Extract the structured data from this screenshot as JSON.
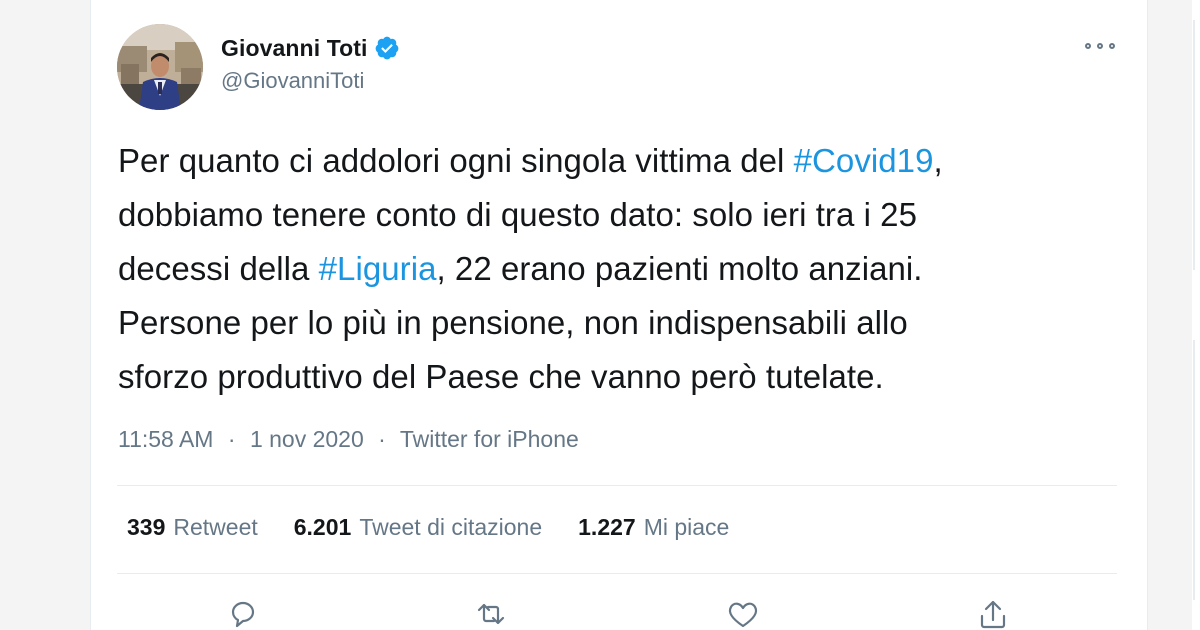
{
  "tweet": {
    "author": {
      "display_name": "Giovanni Toti",
      "handle": "@GiovanniToti",
      "verified": true,
      "verified_color": "#1da1f2"
    },
    "text_lines": [
      {
        "parts": [
          {
            "text": "Per quanto ci addolori ogni singola vittima del ",
            "hashtag": false
          },
          {
            "text": "#Covid19",
            "hashtag": true
          },
          {
            "text": ",",
            "hashtag": false
          }
        ]
      },
      {
        "parts": [
          {
            "text": "dobbiamo tenere conto di questo dato: solo ieri tra i 25",
            "hashtag": false
          }
        ]
      },
      {
        "parts": [
          {
            "text": "decessi della ",
            "hashtag": false
          },
          {
            "text": "#Liguria",
            "hashtag": true
          },
          {
            "text": ", 22 erano pazienti molto anziani.",
            "hashtag": false
          }
        ]
      },
      {
        "parts": [
          {
            "text": "Persone per lo più in pensione, non indispensabili allo",
            "hashtag": false
          }
        ]
      },
      {
        "parts": [
          {
            "text": "sforzo produttivo del Paese che vanno però tutelate.",
            "hashtag": false
          }
        ]
      }
    ],
    "meta": {
      "time": "11:58 AM",
      "date": "1 nov 2020",
      "source": "Twitter for iPhone",
      "separator": "·"
    },
    "stats": [
      {
        "count": "339",
        "label": "Retweet"
      },
      {
        "count": "6.201",
        "label": "Tweet di citazione"
      },
      {
        "count": "1.227",
        "label": "Mi piace"
      }
    ],
    "actions": [
      {
        "name": "reply-icon"
      },
      {
        "name": "retweet-icon"
      },
      {
        "name": "like-icon"
      },
      {
        "name": "share-icon"
      }
    ],
    "colors": {
      "text": "#14171a",
      "secondary": "#657786",
      "link": "#1b95e0",
      "divider": "#e6ecf0"
    }
  }
}
